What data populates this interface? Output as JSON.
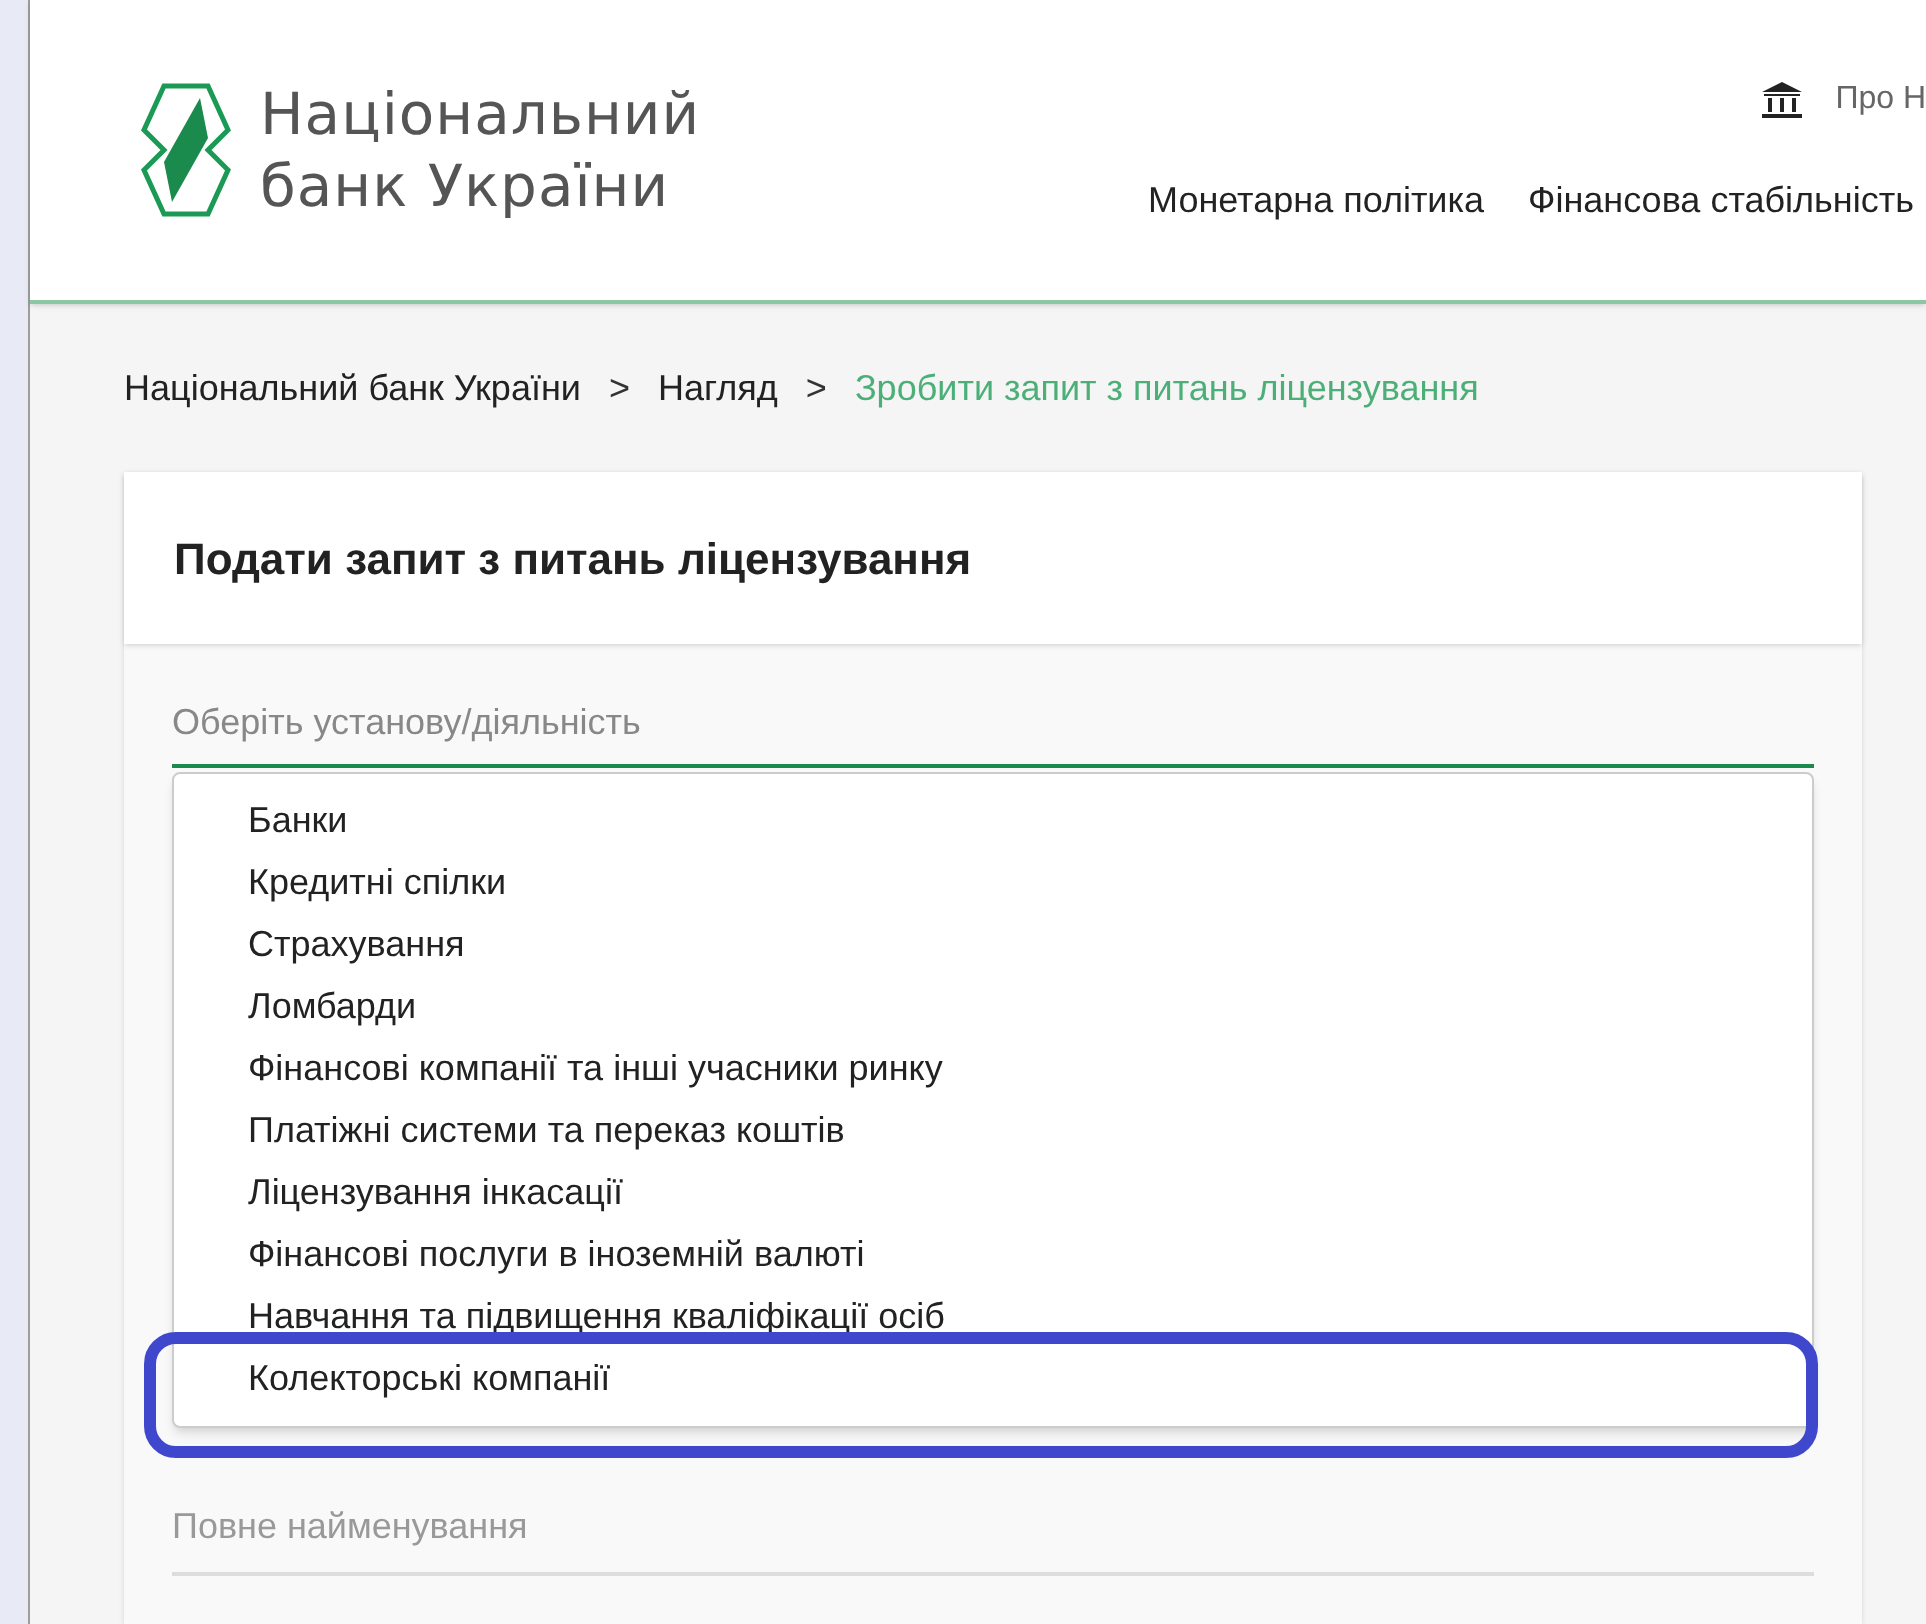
{
  "header": {
    "logo_lines": [
      "Національний",
      "банк України"
    ],
    "top_link": "Про Н",
    "nav": [
      "Монетарна політика",
      "Фінансова стабільність"
    ]
  },
  "breadcrumbs": [
    {
      "label": "Національний банк України",
      "current": false
    },
    {
      "label": "Нагляд",
      "current": false
    },
    {
      "label": "Зробити запит з питань ліцензування",
      "current": true
    }
  ],
  "breadcrumb_separator": ">",
  "card": {
    "title": "Подати запит з питань ліцензування",
    "select": {
      "placeholder": "Оберіть установу/діяльність",
      "expanded": true,
      "options": [
        {
          "label": "Банки",
          "highlighted": false
        },
        {
          "label": "Кредитні спілки",
          "highlighted": false
        },
        {
          "label": "Страхування",
          "highlighted": false
        },
        {
          "label": "Ломбарди",
          "highlighted": false
        },
        {
          "label": "Фінансові компанії та інші учасники ринку",
          "highlighted": false
        },
        {
          "label": "Платіжні системи та переказ коштів",
          "highlighted": false
        },
        {
          "label": "Ліцензування інкасації",
          "highlighted": false
        },
        {
          "label": "Фінансові послуги в іноземній валюті",
          "highlighted": false
        },
        {
          "label": "Навчання та підвищення кваліфікації осіб",
          "highlighted": false
        },
        {
          "label": "Колекторські компанії",
          "highlighted": true
        }
      ]
    },
    "name_field": {
      "placeholder": "Повне найменування"
    }
  }
}
